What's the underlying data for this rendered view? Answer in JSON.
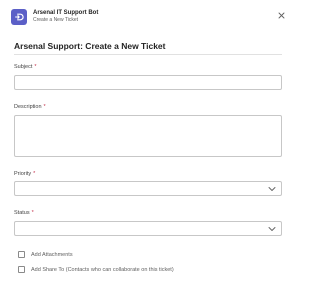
{
  "header": {
    "bot_name": "Arsenal IT Support Bot",
    "subtitle": "Create a New Ticket",
    "logo_icon": "bot-logo-icon",
    "close_icon": "close-icon"
  },
  "form": {
    "title": "Arsenal Support: Create a New Ticket",
    "required_marker": "*",
    "fields": {
      "subject": {
        "label": "Subject",
        "value": ""
      },
      "description": {
        "label": "Description",
        "value": ""
      },
      "priority": {
        "label": "Priority",
        "selected": ""
      },
      "status": {
        "label": "Status",
        "selected": ""
      }
    },
    "checkboxes": {
      "attachments": {
        "label": "Add Attachments",
        "checked": false
      },
      "share": {
        "label": "Add Share To (Contacts who can collaborate on this ticket)",
        "checked": false
      }
    }
  },
  "colors": {
    "accent": "#5b5fc7",
    "required": "#c4314b",
    "border": "#c7c7c7"
  }
}
